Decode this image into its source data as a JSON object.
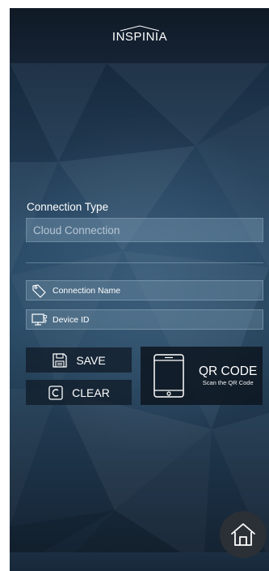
{
  "header": {
    "logo_text": "INSPINIA"
  },
  "connection": {
    "section_title": "Connection Type",
    "type_value": "Cloud Connection"
  },
  "fields": {
    "connection_name": {
      "placeholder": "Connection Name",
      "icon": "tag-icon"
    },
    "device_id": {
      "placeholder": "Device ID",
      "icon": "monitor-key-icon"
    }
  },
  "buttons": {
    "save": {
      "label": "SAVE",
      "icon": "floppy-disk-icon"
    },
    "clear": {
      "label": "CLEAR",
      "icon": "clear-c-icon"
    },
    "qr": {
      "title": "QR CODE",
      "subtitle": "Scan the QR Code",
      "icon": "smartphone-icon"
    },
    "home": {
      "icon": "home-icon"
    }
  },
  "colors": {
    "background_dark": "#142436",
    "background_mid": "#2c4d68",
    "button_dark": "#121e2c",
    "text": "#ffffff"
  }
}
